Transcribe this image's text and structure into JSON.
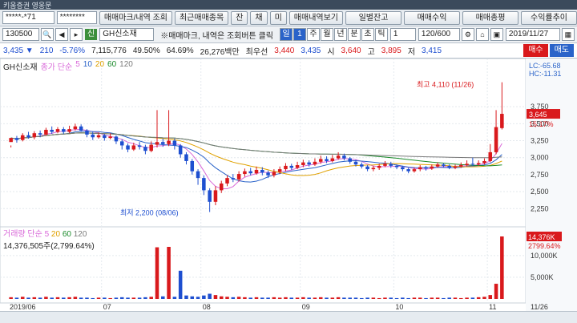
{
  "top_bar": {
    "title": "키움증권 영웅문"
  },
  "toolbar": {
    "account_field": "*****-*71",
    "password_field": "********",
    "btn_trade_mark": "매매마크/내역 조회",
    "btn_recent": "최근매매종목",
    "btn_balance_short": "잔",
    "btn_stock_short": "채",
    "btn_not_short": "미",
    "btn_trade_view": "매매내역보기",
    "btn_daily": "일별잔고",
    "btn_profit": "매매수익",
    "btn_total": "매매총평",
    "btn_rate": "수익률추이"
  },
  "chart_toolbar": {
    "code": "130500",
    "credit_tag": "신",
    "stock_name": "GH신소재",
    "notice": "※매매마크, 내역은 조회버튼 클릭",
    "periods": [
      "일",
      "1",
      "주",
      "월",
      "년",
      "분",
      "초",
      "틱"
    ],
    "count": "1",
    "range": "120/600",
    "date": "2019/11/27"
  },
  "quote": {
    "price": "3,435 ▼",
    "change": "210",
    "change_pct": "-5.76%",
    "volume": "7,115,776",
    "ratio1": "49.50%",
    "ratio2": "64.69%",
    "amount": "26,276백만",
    "best_label": "최우선",
    "best_ask": "3,440",
    "best_bid": "3,435",
    "open_label": "시",
    "open": "3,640",
    "high_label": "고",
    "high": "3,895",
    "low_label": "저",
    "low": "3,415",
    "buy": "매수",
    "sell": "매도"
  },
  "price_legend": {
    "stock": "GH신소재",
    "ma_label": "종가 단순",
    "ma_periods": [
      "5",
      "10",
      "20",
      "60",
      "120"
    ]
  },
  "volume_legend": {
    "label": "거래량 단순",
    "ma_periods": [
      "5",
      "20",
      "60",
      "120"
    ],
    "value": "14,376,505주(2,799.64%)"
  },
  "colors": {
    "up": "#d9191c",
    "down": "#1e4fd0",
    "ma5": "#d96ad9",
    "ma10": "#2a63c9",
    "ma20": "#e0a100",
    "ma60": "#1a8a2a",
    "ma120": "#7a7a7a"
  },
  "chart_data": {
    "type": "candlestick",
    "y_ticks": [
      "3,750",
      "3,500",
      "3,250",
      "3,000",
      "2,750",
      "2,500",
      "2,250"
    ],
    "ylim": [
      2100,
      4200
    ],
    "x_ticks": [
      "2019/06",
      "07",
      "08",
      "09",
      "10",
      "11",
      "11/26"
    ],
    "right_labels": {
      "lc": "LC:-65.68",
      "hc": "HC:-11.31",
      "last_price": "3,645",
      "last_pct": "15.17%"
    },
    "annotations": {
      "high": "최고 4,110 (11/26)",
      "low": "최저 2,200 (08/06)"
    },
    "volume_ticks": [
      "10,000K",
      "5,000K"
    ],
    "volume_right_labels": {
      "value": "14,376K",
      "pct": "2799.64%"
    },
    "candles": [
      [
        3230,
        3290,
        3180,
        3150
      ],
      [
        3290,
        3260,
        3320,
        3220
      ],
      [
        3260,
        3330,
        3360,
        3240
      ],
      [
        3330,
        3300,
        3380,
        3280
      ],
      [
        3300,
        3360,
        3390,
        3270
      ],
      [
        3360,
        3340,
        3400,
        3300
      ],
      [
        3340,
        3410,
        3440,
        3320
      ],
      [
        3410,
        3380,
        3460,
        3350
      ],
      [
        3380,
        3420,
        3450,
        3360
      ],
      [
        3420,
        3380,
        3450,
        3350
      ],
      [
        3380,
        3420,
        3470,
        3360
      ],
      [
        3420,
        3460,
        3500,
        3400
      ],
      [
        3460,
        3400,
        3490,
        3380
      ],
      [
        3400,
        3340,
        3420,
        3300
      ],
      [
        3340,
        3300,
        3380,
        3260
      ],
      [
        3300,
        3330,
        3370,
        3280
      ],
      [
        3330,
        3290,
        3350,
        3250
      ],
      [
        3290,
        3310,
        3360,
        3270
      ],
      [
        3310,
        3240,
        3330,
        3200
      ],
      [
        3240,
        3180,
        3270,
        3120
      ],
      [
        3180,
        3120,
        3210,
        3080
      ],
      [
        3120,
        3180,
        3220,
        3100
      ],
      [
        3180,
        3160,
        3230,
        3120
      ],
      [
        3160,
        3100,
        3190,
        3050
      ],
      [
        3100,
        3190,
        3240,
        3080
      ],
      [
        3190,
        3230,
        3700,
        3150
      ],
      [
        3230,
        3200,
        3280,
        3160
      ],
      [
        3200,
        3250,
        3700,
        3170
      ],
      [
        3250,
        3180,
        3280,
        3120
      ],
      [
        3180,
        3050,
        3200,
        3000
      ],
      [
        3050,
        2950,
        3080,
        2900
      ],
      [
        2950,
        2800,
        2980,
        2750
      ],
      [
        2800,
        2700,
        2830,
        2600
      ],
      [
        2700,
        2520,
        2740,
        2450
      ],
      [
        2520,
        2350,
        2550,
        2200
      ],
      [
        2350,
        2520,
        2580,
        2300
      ],
      [
        2520,
        2620,
        2660,
        2480
      ],
      [
        2620,
        2700,
        2740,
        2580
      ],
      [
        2700,
        2680,
        2760,
        2640
      ],
      [
        2680,
        2760,
        2800,
        2650
      ],
      [
        2760,
        2800,
        2840,
        2720
      ],
      [
        2800,
        2770,
        2850,
        2740
      ],
      [
        2770,
        2820,
        2870,
        2750
      ],
      [
        2820,
        2780,
        2860,
        2740
      ],
      [
        2780,
        2740,
        2810,
        2700
      ],
      [
        2740,
        2790,
        2830,
        2710
      ],
      [
        2790,
        2830,
        2870,
        2760
      ],
      [
        2830,
        2880,
        2920,
        2800
      ],
      [
        2880,
        2850,
        2910,
        2820
      ],
      [
        2850,
        2890,
        2940,
        2830
      ],
      [
        2890,
        2930,
        2970,
        2860
      ],
      [
        2930,
        2900,
        2960,
        2870
      ],
      [
        2900,
        2940,
        2990,
        2880
      ],
      [
        2940,
        2980,
        3030,
        2910
      ],
      [
        2980,
        2950,
        3020,
        2920
      ],
      [
        2950,
        2990,
        3040,
        2930
      ],
      [
        2990,
        3030,
        3080,
        2970
      ],
      [
        3030,
        2990,
        3060,
        2960
      ],
      [
        2990,
        2940,
        3010,
        2910
      ],
      [
        2940,
        2900,
        2970,
        2870
      ],
      [
        2900,
        2870,
        2930,
        2840
      ],
      [
        2870,
        2830,
        2890,
        2800
      ],
      [
        2830,
        2850,
        2880,
        2800
      ],
      [
        2850,
        2880,
        2910,
        2820
      ],
      [
        2880,
        2910,
        2950,
        2860
      ],
      [
        2910,
        2880,
        2940,
        2850
      ],
      [
        2880,
        2860,
        2900,
        2830
      ],
      [
        2860,
        2830,
        2880,
        2800
      ],
      [
        2830,
        2800,
        2850,
        2770
      ],
      [
        2800,
        2830,
        2860,
        2780
      ],
      [
        2830,
        2860,
        2890,
        2800
      ],
      [
        2860,
        2840,
        2880,
        2810
      ],
      [
        2840,
        2870,
        2900,
        2820
      ],
      [
        2870,
        2900,
        2930,
        2850
      ],
      [
        2900,
        2880,
        2920,
        2850
      ],
      [
        2880,
        2850,
        2900,
        2830
      ],
      [
        2850,
        2870,
        2900,
        2830
      ],
      [
        2870,
        2890,
        2930,
        2850
      ],
      [
        2890,
        2910,
        2960,
        2870
      ],
      [
        2910,
        2900,
        3000,
        2880
      ],
      [
        2900,
        2920,
        2960,
        2880
      ],
      [
        2920,
        2950,
        2990,
        2900
      ],
      [
        2950,
        3080,
        3200,
        2930
      ],
      [
        3080,
        3450,
        3700,
        3050
      ],
      [
        3435,
        3645,
        4110,
        3415
      ]
    ],
    "volumes": [
      0.4,
      0.3,
      0.5,
      0.3,
      0.4,
      0.3,
      0.5,
      0.3,
      0.4,
      0.3,
      0.4,
      0.5,
      0.3,
      0.3,
      0.2,
      0.3,
      0.3,
      0.2,
      0.3,
      0.4,
      0.3,
      0.3,
      0.3,
      0.4,
      0.5,
      11.9,
      0.6,
      12.0,
      0.5,
      6.5,
      0.8,
      0.6,
      0.5,
      0.8,
      1.2,
      0.9,
      0.6,
      0.5,
      0.4,
      0.5,
      0.4,
      0.3,
      0.4,
      0.3,
      0.3,
      0.4,
      0.3,
      0.4,
      0.3,
      0.3,
      0.4,
      0.3,
      0.3,
      0.4,
      0.3,
      0.3,
      0.4,
      0.3,
      0.3,
      0.3,
      0.2,
      0.3,
      0.3,
      0.2,
      0.3,
      0.3,
      0.2,
      0.3,
      0.2,
      0.3,
      0.3,
      0.2,
      0.3,
      0.3,
      0.2,
      0.3,
      0.3,
      0.2,
      0.3,
      0.3,
      0.4,
      0.5,
      0.9,
      3.5,
      14.4
    ]
  }
}
